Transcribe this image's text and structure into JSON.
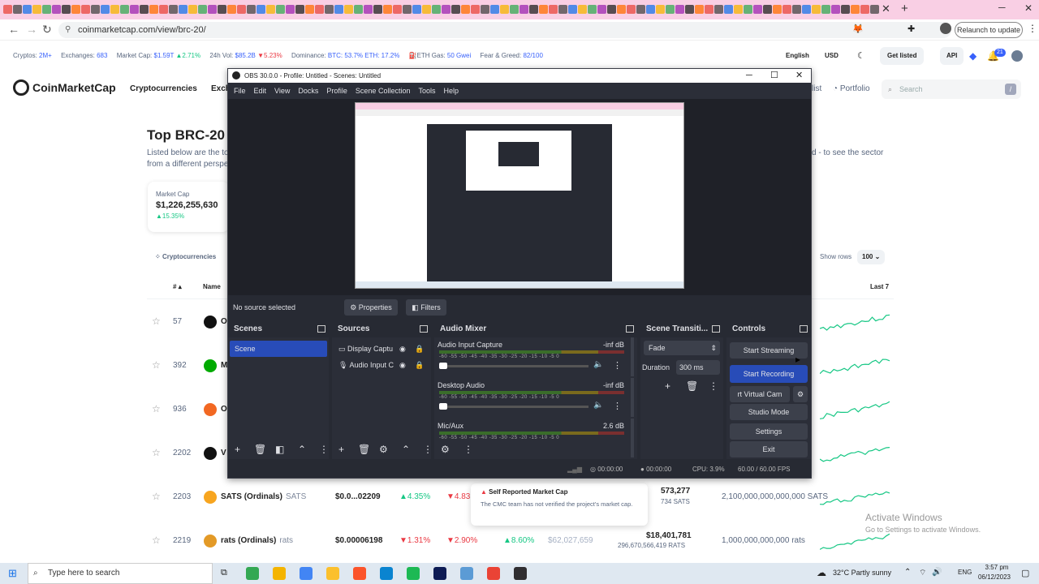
{
  "browser": {
    "url": "coinmarketcap.com/view/brc-20/",
    "relaunch_label": "Relaunch to update"
  },
  "cmc": {
    "stats": {
      "cryptos_label": "Cryptos:",
      "cryptos_value": "2M+",
      "exchanges_label": "Exchanges:",
      "exchanges_value": "683",
      "marketcap_label": "Market Cap:",
      "marketcap_value": "$1.59T",
      "marketcap_change": "▲2.71%",
      "vol_label": "24h Vol:",
      "vol_value": "$85.2B",
      "vol_change": "▼5.23%",
      "dominance_label": "Dominance:",
      "dominance_value": "BTC: 53.7% ETH: 17.2%",
      "gas_label": "ETH Gas:",
      "gas_value": "50 Gwei",
      "fear_label": "Fear & Greed:",
      "fear_value": "82/100"
    },
    "header_right": {
      "language": "English",
      "currency": "USD",
      "get_listed": "Get listed",
      "api": "API",
      "notif_count": "21"
    },
    "logo_text": "CoinMarketCap",
    "nav": {
      "cryptocurrencies": "Cryptocurrencies",
      "exchanges_trunc": "Exch",
      "watchlist_trunc": "list",
      "portfolio": "Portfolio",
      "search_placeholder": "Search",
      "search_shortcut": "/"
    },
    "page_title": "Top BRC-20",
    "desc_line1": "Listed below are the to",
    "desc_line2": "from a different perspe",
    "desc_right": "d - to see the sector",
    "market_cap_card": {
      "label": "Market Cap",
      "value": "$1,226,255,630",
      "change": "▲15.35%"
    },
    "cryptocurrencies_tab": "Cryptocurrencies",
    "show_rows_label": "Show rows",
    "show_rows_value": "100",
    "table_headers": {
      "rank": "#",
      "name": "Name",
      "last7": "Last 7"
    },
    "rows": [
      {
        "rank": "57",
        "name": "O",
        "sym": "",
        "color": "#111"
      },
      {
        "rank": "392",
        "name": "M",
        "sym": "",
        "color": "#0a0"
      },
      {
        "rank": "936",
        "name": "O",
        "sym": "",
        "color": "#f26822"
      },
      {
        "rank": "2202",
        "name": "V",
        "sym": "",
        "color": "#111"
      },
      {
        "rank": "2203",
        "name": "SATS (Ordinals)",
        "sym": "SATS",
        "color": "#f7a51f",
        "price": "$0.0...02209",
        "h1": "▲4.35%",
        "h24": "▼4.83",
        "mcap": "573,277",
        "circ": "734 SATS",
        "maxsupply": "2,100,000,000,000,000 SATS"
      },
      {
        "rank": "2219",
        "name": "rats (Ordinals)",
        "sym": "rats",
        "color": "#e39a27",
        "price": "$0.00006198",
        "h1": "▼1.31%",
        "h24": "▼2.90%",
        "d7": "▲8.60%",
        "mcap": "$62,027,659",
        "vol": "$18,401,781",
        "vol_sub": "296,670,566,419 RATS",
        "maxsupply": "1,000,000,000,000 rats"
      }
    ],
    "popup": {
      "title": "Self Reported Market Cap",
      "body": "The CMC team has not verified the project's market cap."
    },
    "activate": {
      "title": "Activate Windows",
      "sub": "Go to Settings to activate Windows."
    }
  },
  "obs": {
    "title": "OBS 30.0.0 - Profile: Untitled - Scenes: Untitled",
    "menu": [
      "File",
      "Edit",
      "View",
      "Docks",
      "Profile",
      "Scene Collection",
      "Tools",
      "Help"
    ],
    "no_source": "No source selected",
    "properties": "Properties",
    "filters": "Filters",
    "docks": {
      "scenes": "Scenes",
      "sources": "Sources",
      "audio_mixer": "Audio Mixer",
      "transitions": "Scene Transiti...",
      "controls": "Controls"
    },
    "scene_item": "Scene",
    "sources": [
      "Display Captu",
      "Audio Input C"
    ],
    "audio": [
      {
        "name": "Audio Input Capture",
        "level": "-inf dB"
      },
      {
        "name": "Desktop Audio",
        "level": "-inf dB"
      },
      {
        "name": "Mic/Aux",
        "level": "2.6 dB"
      }
    ],
    "scale_text": "-60 -55 -50 -45 -40 -35 -30 -25 -20 -15 -10 -5 0",
    "transition": {
      "type": "Fade",
      "duration_label": "Duration",
      "duration_value": "300 ms"
    },
    "controls": {
      "start_streaming": "Start Streaming",
      "start_recording": "Start Recording",
      "virtual_cam": "rt Virtual Cam",
      "studio_mode": "Studio Mode",
      "settings": "Settings",
      "exit": "Exit"
    },
    "status": {
      "stream_time": "00:00:00",
      "rec_time": "00:00:00",
      "cpu": "CPU: 3.9%",
      "fps": "60.00 / 60.00 FPS"
    }
  },
  "taskbar": {
    "search_placeholder": "Type here to search",
    "weather": "32°C  Partly sunny",
    "lang": "ENG",
    "time": "3:57 pm",
    "date": "06/12/2023"
  }
}
